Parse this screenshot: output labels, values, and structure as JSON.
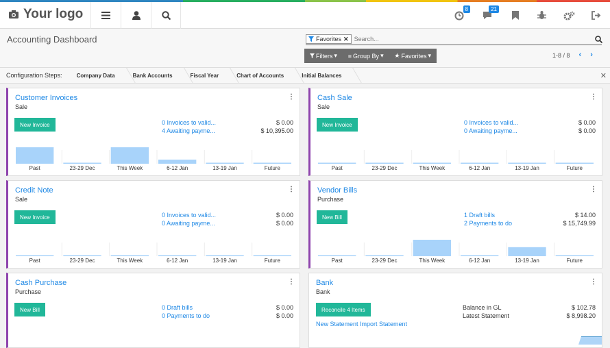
{
  "topbar": {
    "logo": "Your logo",
    "icons": [
      "camera-icon",
      "menu-icon",
      "user-icon",
      "search-icon"
    ],
    "activity_badge": "8",
    "messages_badge": "21"
  },
  "control": {
    "title": "Accounting Dashboard",
    "facet": "Favorites",
    "search_placeholder": "Search...",
    "filters": "Filters",
    "group_by": "Group By",
    "favorites": "Favorites",
    "pager": "1-8 / 8"
  },
  "config": {
    "label": "Configuration Steps:",
    "steps": [
      "Company Data",
      "Bank Accounts",
      "Fiscal Year",
      "Chart of Accounts",
      "Initial Balances"
    ]
  },
  "chart_labels": [
    "Past",
    "23-29 Dec",
    "This Week",
    "6-12 Jan",
    "13-19 Jan",
    "Future"
  ],
  "cards": [
    {
      "title": "Customer Invoices",
      "sub": "Sale",
      "button": "New Invoice",
      "rows": [
        {
          "link": "0 Invoices to valid...",
          "amount": "$ 0.00"
        },
        {
          "link": "4 Awaiting payme...",
          "amount": "$ 10,395.00"
        }
      ],
      "bars": [
        1.0,
        0,
        1.0,
        0.25,
        0,
        0
      ]
    },
    {
      "title": "Cash Sale",
      "sub": "Sale",
      "button": "New Invoice",
      "rows": [
        {
          "link": "0 Invoices to valid...",
          "amount": "$ 0.00"
        },
        {
          "link": "0 Awaiting payme...",
          "amount": "$ 0.00"
        }
      ],
      "bars": [
        0,
        0,
        0,
        0,
        0,
        0
      ]
    },
    {
      "title": "Credit Note",
      "sub": "Sale",
      "button": "New Invoice",
      "rows": [
        {
          "link": "0 Invoices to valid...",
          "amount": "$ 0.00"
        },
        {
          "link": "0 Awaiting payme...",
          "amount": "$ 0.00"
        }
      ],
      "bars": [
        0,
        0,
        0,
        0,
        0,
        0
      ]
    },
    {
      "title": "Vendor Bills",
      "sub": "Purchase",
      "button": "New Bill",
      "rows": [
        {
          "link": "1 Draft bills",
          "amount": "$ 14.00"
        },
        {
          "link": "2 Payments to do",
          "amount": "$ 15,749.99"
        }
      ],
      "bars": [
        0,
        0,
        1.0,
        0,
        0.55,
        0
      ]
    },
    {
      "title": "Cash Purchase",
      "sub": "Purchase",
      "button": "New Bill",
      "rows": [
        {
          "link": "0 Draft bills",
          "amount": "$ 0.00"
        },
        {
          "link": "0 Payments to do",
          "amount": "$ 0.00"
        }
      ]
    },
    {
      "title": "Bank",
      "sub": "Bank",
      "button": "Reconcile 4 Items",
      "extra_link": "New Statement Import Statement",
      "rows": [
        {
          "label": "Balance in GL",
          "amount": "$ 102.78"
        },
        {
          "label": "Latest Statement",
          "amount": "$ 8,998.20"
        }
      ]
    }
  ]
}
